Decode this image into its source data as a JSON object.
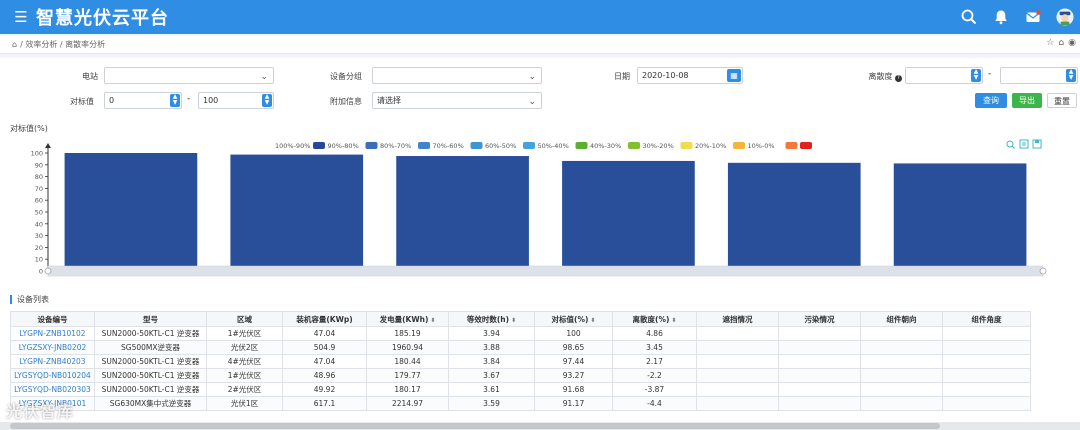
{
  "app": {
    "title": "智慧光伏云平台"
  },
  "breadcrumb": {
    "path": "/ 效率分析 / 离散率分析"
  },
  "filters": {
    "station_label": "电站",
    "station_value": "",
    "group_label": "设备分组",
    "group_value": "",
    "date_label": "日期",
    "date_value": "2020-10-08",
    "dispersion_label": "离散度",
    "dispersion_from": "",
    "dispersion_to": "",
    "benchmark_label": "对标值",
    "benchmark_from": "0",
    "benchmark_to": "100",
    "extra_label": "附加信息",
    "extra_value": "请选择",
    "range_sep": "-"
  },
  "buttons": {
    "query": "查询",
    "export": "导出",
    "reset": "重置"
  },
  "colors": {
    "accent": "#2f8de4",
    "query": "#2f8de4",
    "export": "#3cb54a",
    "reset": "#2f8de4",
    "bar": "#2a4f9a"
  },
  "chart_data": {
    "type": "bar",
    "ylabel": "对标值(%)",
    "ylim": [
      0,
      100
    ],
    "yticks": [
      0,
      10,
      20,
      30,
      40,
      50,
      60,
      70,
      80,
      90,
      100
    ],
    "legend_position": "top",
    "legend": [
      {
        "name": "100%-90%",
        "color": "#27479a"
      },
      {
        "name": "90%-80%",
        "color": "#3a70b8"
      },
      {
        "name": "80%-70%",
        "color": "#3f86c8"
      },
      {
        "name": "70%-60%",
        "color": "#3f95d2"
      },
      {
        "name": "60%-50%",
        "color": "#44a4d9"
      },
      {
        "name": "50%-40%",
        "color": "#5cb031"
      },
      {
        "name": "40%-30%",
        "color": "#80bf2f"
      },
      {
        "name": "30%-20%",
        "color": "#f0dc50"
      },
      {
        "name": "20%-10%",
        "color": "#f4b53a"
      },
      {
        "name": "10%-0%",
        "color": "#f0783a"
      },
      {
        "name": "",
        "color": "#e0221c"
      }
    ],
    "values": [
      100,
      98.65,
      97.44,
      93.27,
      91.68,
      91.17
    ]
  },
  "table": {
    "section_title": "设备列表",
    "columns": [
      "设备编号",
      "型号",
      "区域",
      "装机容量(KWp)",
      "发电量(KWh)",
      "等效时数(h)",
      "对标值(%)",
      "离散度(%)",
      "遮挡情况",
      "污染情况",
      "组件朝向",
      "组件角度"
    ],
    "sortable": [
      false,
      false,
      false,
      false,
      true,
      true,
      true,
      true,
      false,
      false,
      false,
      false
    ],
    "rows": [
      [
        "LYGPN-ZNB10102",
        "SUN2000-50KTL-C1 逆变器",
        "1#光伏区",
        "47.04",
        "185.19",
        "3.94",
        "100",
        "4.86",
        "",
        "",
        "",
        ""
      ],
      [
        "LYGZSXY-JNB0202",
        "SG500MX逆变器",
        "光伏2区",
        "504.9",
        "1960.94",
        "3.88",
        "98.65",
        "3.45",
        "",
        "",
        "",
        ""
      ],
      [
        "LYGPN-ZNB40203",
        "SUN2000-50KTL-C1 逆变器",
        "4#光伏区",
        "47.04",
        "180.44",
        "3.84",
        "97.44",
        "2.17",
        "",
        "",
        "",
        ""
      ],
      [
        "LYGSYQD-NB010204",
        "SUN2000-50KTL-C1 逆变器",
        "1#光伏区",
        "48.96",
        "179.77",
        "3.67",
        "93.27",
        "-2.2",
        "",
        "",
        "",
        ""
      ],
      [
        "LYGSYQD-NB020303",
        "SUN2000-50KTL-C1 逆变器",
        "2#光伏区",
        "49.92",
        "180.17",
        "3.61",
        "91.68",
        "-3.87",
        "",
        "",
        "",
        ""
      ],
      [
        "LYGZSXY-JNB0101",
        "SG630MX集中式逆变器",
        "光伏1区",
        "617.1",
        "2214.97",
        "3.59",
        "91.17",
        "-4.4",
        "",
        "",
        "",
        ""
      ]
    ]
  },
  "watermark": "光伏智库"
}
